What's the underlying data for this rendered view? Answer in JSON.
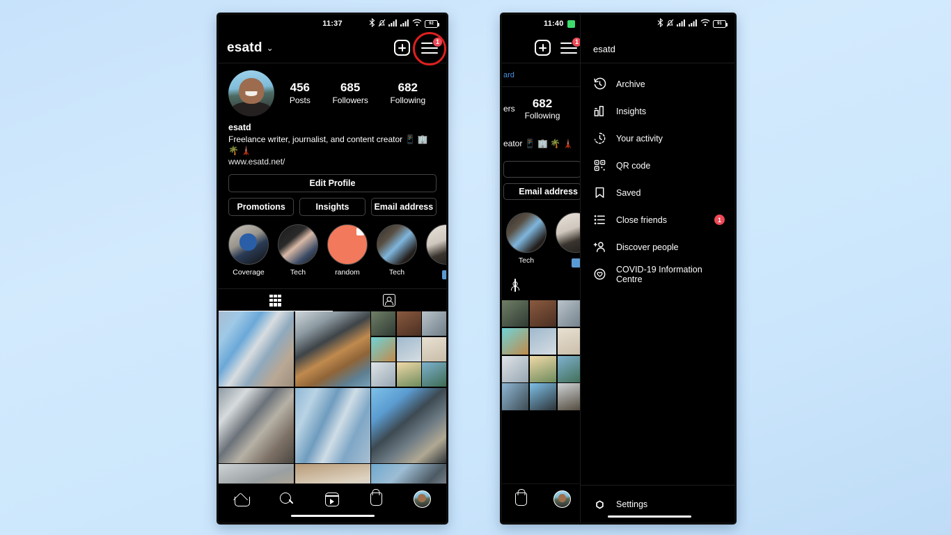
{
  "background": {
    "color_top": "#c7e2fb",
    "color_bottom": "#bfdcf7"
  },
  "left_phone": {
    "status_bar": {
      "time": "11:37",
      "battery_label": "92",
      "icons": [
        "bluetooth-icon",
        "bell-muted-icon",
        "signal-icon",
        "signal-icon",
        "wifi-icon",
        "battery-icon"
      ]
    },
    "header": {
      "username": "esatd",
      "chevron": "⌄",
      "add_label": "+",
      "menu_badge": "1"
    },
    "profile": {
      "stats": [
        {
          "num": "456",
          "label": "Posts"
        },
        {
          "num": "685",
          "label": "Followers"
        },
        {
          "num": "682",
          "label": "Following"
        }
      ],
      "display_name": "esatd",
      "bio": "Freelance writer, journalist, and content creator 📱 🏢 🌴 🗼",
      "website": "www.esatd.net/"
    },
    "buttons": {
      "edit_profile": "Edit Profile",
      "promotions": "Promotions",
      "insights": "Insights",
      "email_address": "Email address"
    },
    "highlights": [
      {
        "label": "Coverage",
        "style": "hl-a"
      },
      {
        "label": "Tech",
        "style": "hl-b"
      },
      {
        "label": "random",
        "style": "hl-c"
      },
      {
        "label": "Tech",
        "style": "hl-d"
      },
      {
        "label": "",
        "style": "hl-e"
      }
    ],
    "tabs": [
      {
        "icon": "grid-icon",
        "active": true
      },
      {
        "icon": "tagged-person-icon",
        "active": false
      }
    ],
    "photo_grid": {
      "rows": 3,
      "columns": 3,
      "description": "architecture photo grid"
    },
    "bottom_nav": [
      {
        "icon": "home-icon",
        "label": "Home"
      },
      {
        "icon": "search-icon",
        "label": "Search"
      },
      {
        "icon": "reels-icon",
        "label": "Reels"
      },
      {
        "icon": "shop-icon",
        "label": "Shop"
      },
      {
        "icon": "profile-avatar-icon",
        "label": "Profile"
      }
    ]
  },
  "right_phone": {
    "status_bar": {
      "time": "11:40",
      "battery_label": "91",
      "app_badge": "green-app-icon",
      "icons": [
        "bluetooth-icon",
        "bell-muted-icon",
        "signal-icon",
        "signal-icon",
        "wifi-icon",
        "battery-icon"
      ]
    },
    "header": {
      "add_label": "+",
      "menu_badge": "1"
    },
    "behind_profile": {
      "dashboard_fragment": "ard",
      "followers_fragment": "ers",
      "following_num": "682",
      "following_label": "Following",
      "bio_fragment": "eator 📱 🏢 🌴 🗼",
      "email_address": "Email address",
      "highlight_label": "Tech"
    },
    "drawer": {
      "username": "esatd",
      "items": [
        {
          "label": "Archive",
          "icon": "archive-clock-icon",
          "badge": ""
        },
        {
          "label": "Insights",
          "icon": "insights-bar-chart-icon",
          "badge": ""
        },
        {
          "label": "Your activity",
          "icon": "your-activity-clock-icon",
          "badge": ""
        },
        {
          "label": "QR code",
          "icon": "qr-code-icon",
          "badge": ""
        },
        {
          "label": "Saved",
          "icon": "bookmark-icon",
          "badge": ""
        },
        {
          "label": "Close friends",
          "icon": "close-friends-list-icon",
          "badge": "1"
        },
        {
          "label": "Discover people",
          "icon": "discover-people-icon",
          "badge": ""
        },
        {
          "label": "COVID-19 Information Centre",
          "icon": "covid-info-icon",
          "badge": ""
        }
      ],
      "footer": {
        "label": "Settings",
        "icon": "settings-gear-icon"
      }
    }
  }
}
